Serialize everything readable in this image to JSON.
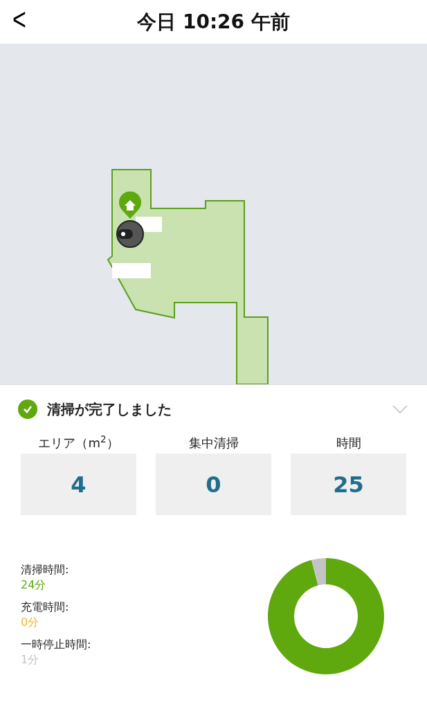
{
  "header": {
    "back": "<",
    "title": "今日 10:26 午前"
  },
  "status": {
    "done": true,
    "text": "清掃が完了しました",
    "expanded": false
  },
  "stats": [
    {
      "label": "エリア（m$^{2}$）",
      "value": "4"
    },
    {
      "label": "集中清掃",
      "value": "0"
    },
    {
      "label": "時間",
      "value": "25"
    }
  ],
  "breakdown": [
    {
      "label": "清掃時間:",
      "value": "24分",
      "color": "#5fa80e"
    },
    {
      "label": "充電時間:",
      "value": "0分",
      "color": "#f2b632"
    },
    {
      "label": "一時停止時間:",
      "value": "1分",
      "color": "#c4c4c4"
    }
  ],
  "chart_data": {
    "type": "donut",
    "values": [
      96,
      0,
      4
    ]
  }
}
